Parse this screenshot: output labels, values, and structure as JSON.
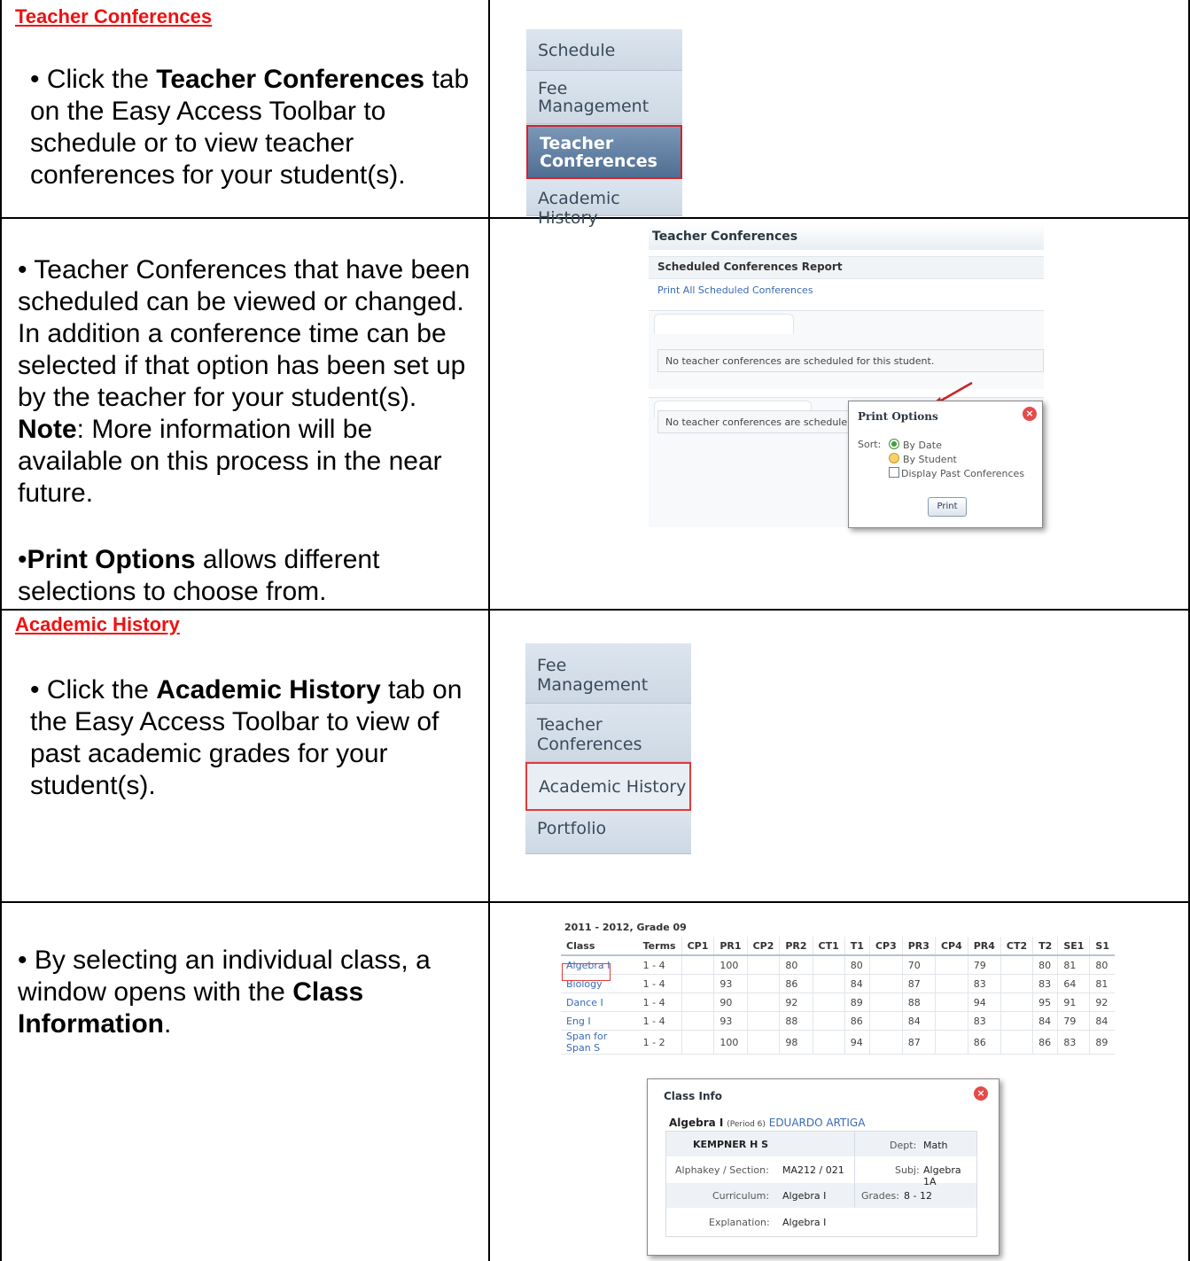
{
  "section1": {
    "heading": "Teacher Conferences",
    "bullet": "• Click the ",
    "bold": "Teacher Conferences",
    "rest": " tab on the Easy Access Toolbar to schedule or to view teacher conferences for your student(s).",
    "menu": [
      "Schedule",
      "Fee Management",
      "Teacher Conferences",
      "Academic History"
    ]
  },
  "section2": {
    "text1": "• Teacher Conferences that have been scheduled can be viewed or changed.  In addition a conference time can be selected if that option has been set up by the teacher for your student(s).  ",
    "note_label": "Note",
    "text2": ":  More information will be available on this process in the near future.",
    "bullet2": "•",
    "print_bold": "Print Options",
    "text3": " allows different selections to choose from.",
    "screen": {
      "title": "Teacher Conferences",
      "report": "Scheduled Conferences Report",
      "link": "Print All Scheduled Conferences",
      "msg1": "No teacher conferences are scheduled for this student.",
      "msg2": "No teacher conferences are schedule",
      "popup_title": "Print Options",
      "sort_label": "Sort:",
      "opt1": "By Date",
      "opt2": "By Student",
      "opt3": "Display Past Conferences",
      "print_btn": "Print"
    }
  },
  "section3": {
    "heading": "Academic History",
    "bullet": "• Click the ",
    "bold": "Academic History",
    "rest": " tab on the Easy Access Toolbar to view of past academic grades for your student(s).",
    "menu": [
      "Fee Management",
      "Teacher Conferences",
      "Academic History",
      "Portfolio"
    ]
  },
  "section4": {
    "text1": "• By selecting an individual class, a window opens with the ",
    "bold": "Class Information",
    "text2": ".",
    "table_title": "2011 - 2012, Grade 09",
    "headers": [
      "Class",
      "Terms",
      "CP1",
      "PR1",
      "CP2",
      "PR2",
      "CT1",
      "T1",
      "CP3",
      "PR3",
      "CP4",
      "PR4",
      "CT2",
      "T2",
      "SE1",
      "S1"
    ],
    "rows": [
      [
        "Algebra I",
        "1 - 4",
        "",
        "100",
        "",
        "80",
        "",
        "80",
        "",
        "70",
        "",
        "79",
        "",
        "80",
        "81",
        "80"
      ],
      [
        "Biology",
        "1 - 4",
        "",
        "93",
        "",
        "86",
        "",
        "84",
        "",
        "87",
        "",
        "83",
        "",
        "83",
        "64",
        "81"
      ],
      [
        "Dance I",
        "1 - 4",
        "",
        "90",
        "",
        "92",
        "",
        "89",
        "",
        "88",
        "",
        "94",
        "",
        "95",
        "91",
        "92"
      ],
      [
        "Eng I",
        "1 - 4",
        "",
        "93",
        "",
        "88",
        "",
        "86",
        "",
        "84",
        "",
        "83",
        "",
        "84",
        "79",
        "84"
      ],
      [
        "Span for Span S",
        "1 - 2",
        "",
        "100",
        "",
        "98",
        "",
        "94",
        "",
        "87",
        "",
        "86",
        "",
        "86",
        "83",
        "89"
      ]
    ],
    "info": {
      "title": "Class Info",
      "class_name": "Algebra I",
      "period": "(Period 6)",
      "teacher": "EDUARDO ARTIGA",
      "school": "KEMPNER H S",
      "dept_label": "Dept:",
      "dept": "Math",
      "alpha_label": "Alphakey / Section:",
      "alpha": "MA212 / 021",
      "subj_label": "Subj:",
      "subj": "Algebra 1A",
      "curr_label": "Curriculum:",
      "curr": "Algebra I",
      "grades_label": "Grades:",
      "grades": "8 - 12",
      "expl_label": "Explanation:",
      "expl": "Algebra I"
    }
  }
}
